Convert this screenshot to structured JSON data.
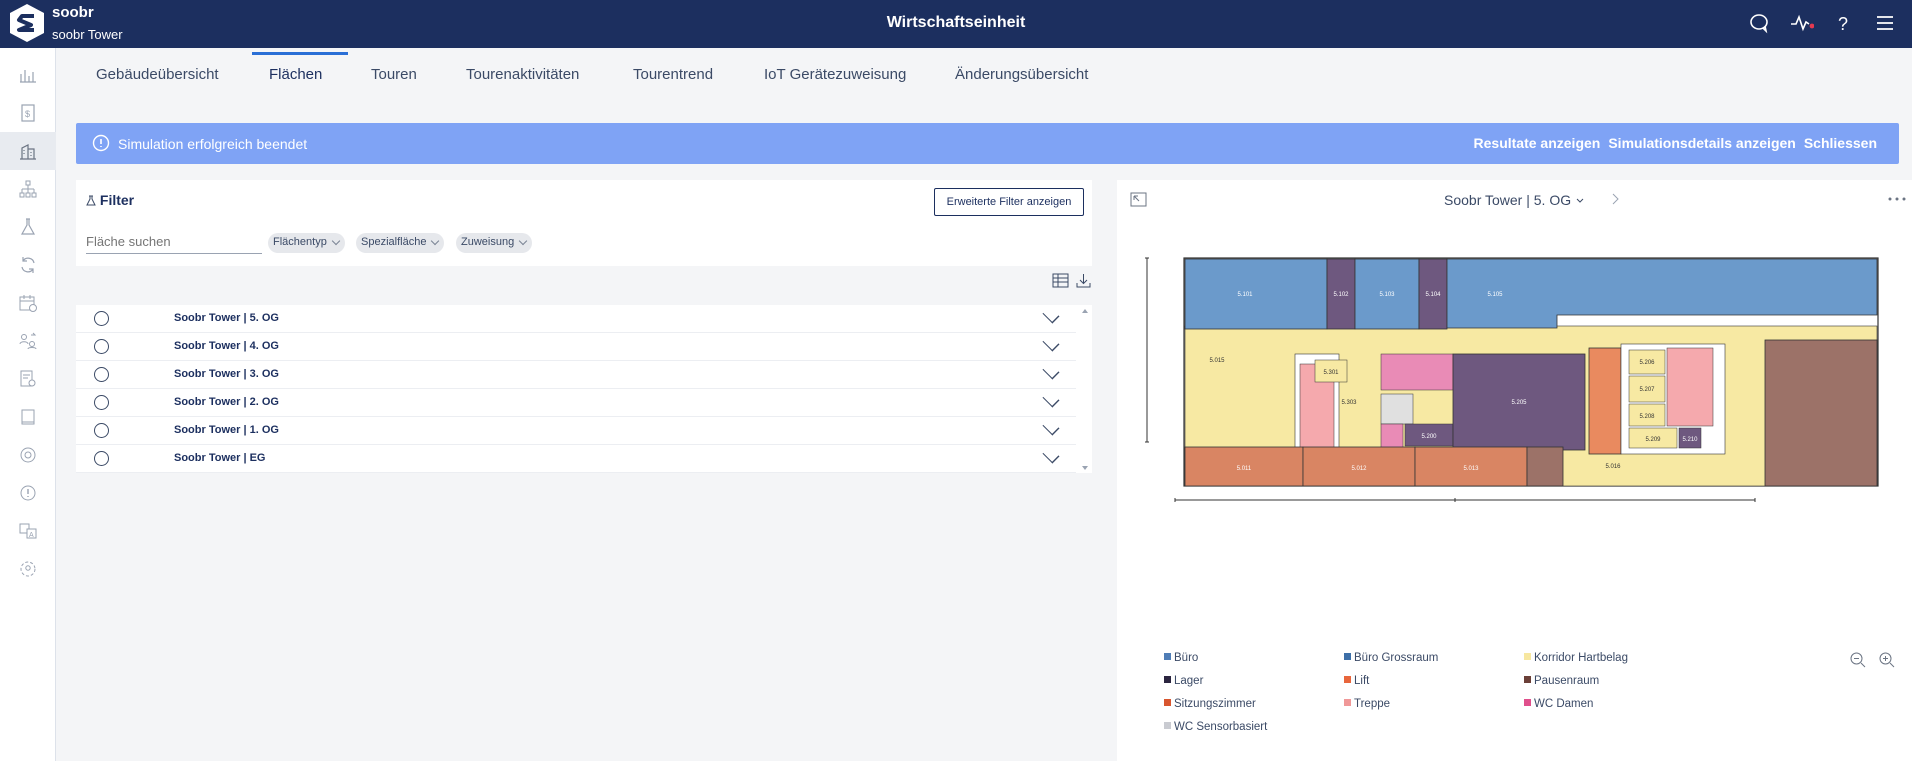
{
  "header": {
    "brand": "soobr",
    "building": "soobr Tower",
    "title": "Wirtschaftseinheit"
  },
  "tabs": [
    {
      "label": "Gebäudeübersicht"
    },
    {
      "label": "Flächen"
    },
    {
      "label": "Touren"
    },
    {
      "label": "Tourenaktivitäten"
    },
    {
      "label": "Tourentrend"
    },
    {
      "label": "IoT Gerätezuweisung"
    },
    {
      "label": "Änderungsübersicht"
    }
  ],
  "alert": {
    "text": "Simulation erfolgreich beendet",
    "actions": [
      "Resultate anzeigen",
      "Simulationsdetails anzeigen",
      "Schliessen"
    ]
  },
  "filter": {
    "title": "Filter",
    "extended_button": "Erweiterte Filter anzeigen",
    "search_placeholder": "Fläche suchen",
    "chips": [
      "Flächentyp",
      "Spezialfläche",
      "Zuweisung"
    ]
  },
  "floors": [
    {
      "label": "Soobr Tower | 5. OG"
    },
    {
      "label": "Soobr Tower | 4. OG"
    },
    {
      "label": "Soobr Tower | 3. OG"
    },
    {
      "label": "Soobr Tower | 2. OG"
    },
    {
      "label": "Soobr Tower | 1. OG"
    },
    {
      "label": "Soobr Tower | EG"
    }
  ],
  "plan": {
    "selected_floor": "Soobr Tower | 5. OG",
    "rooms": [
      "5.101",
      "5.102",
      "5.103",
      "5.104",
      "5.105",
      "5.015",
      "5.301",
      "5.303",
      "5.205",
      "5.206",
      "5.207",
      "5.208",
      "5.209",
      "5.210",
      "5.200",
      "5.011",
      "5.012",
      "5.013",
      "5.016"
    ]
  },
  "legend": [
    {
      "label": "Büro",
      "color": "#4f7db6"
    },
    {
      "label": "Büro Grossraum",
      "color": "#3d6fa8"
    },
    {
      "label": "Korridor Hartbelag",
      "color": "#f7e7a0"
    },
    {
      "label": "Lager",
      "color": "#2b2540"
    },
    {
      "label": "Lift",
      "color": "#e8663c"
    },
    {
      "label": "Pausenraum",
      "color": "#6b4038"
    },
    {
      "label": "Sitzungszimmer",
      "color": "#d8562f"
    },
    {
      "label": "Treppe",
      "color": "#f09898"
    },
    {
      "label": "WC Damen",
      "color": "#e0508c"
    },
    {
      "label": "WC Sensorbasiert",
      "color": "#c9cbd1"
    }
  ]
}
